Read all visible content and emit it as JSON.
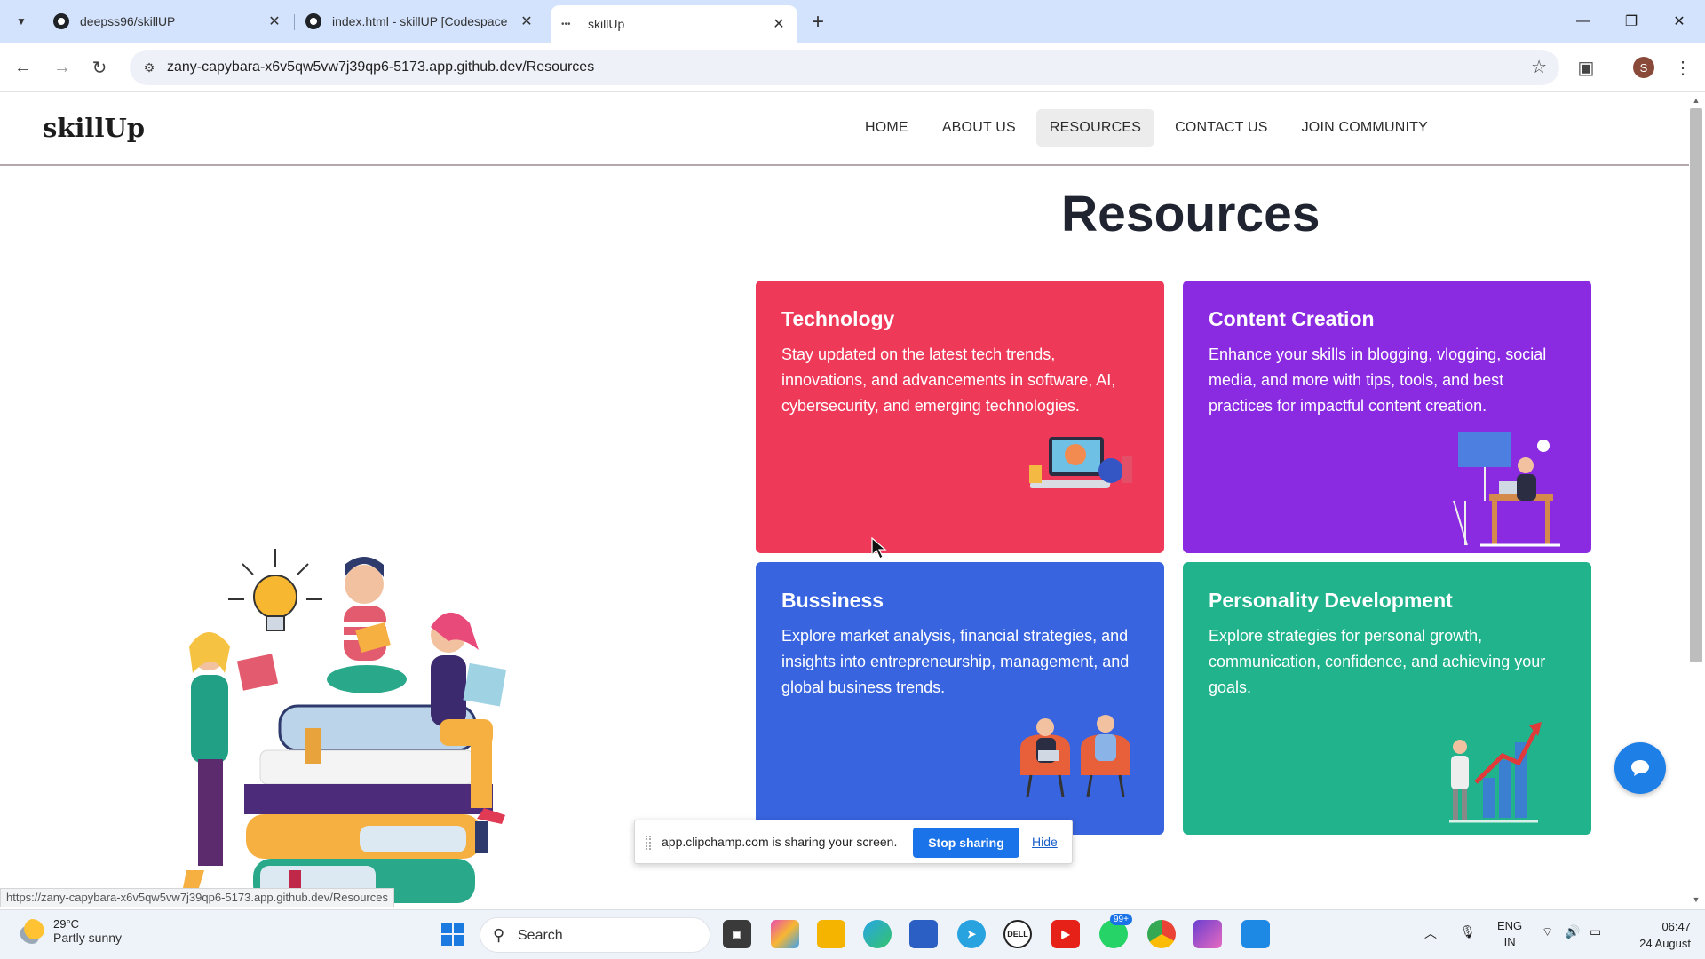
{
  "browser": {
    "tabs": [
      {
        "title": "deepss96/skillUP",
        "active": false
      },
      {
        "title": "index.html - skillUP [Codespace",
        "active": false
      },
      {
        "title": "skillUp",
        "active": true
      }
    ],
    "url": "zany-capybara-x6v5qw5vw7j39qp6-5173.app.github.dev/Resources",
    "profile_initial": "S"
  },
  "site": {
    "logo": "skillUp",
    "nav": [
      {
        "label": "HOME",
        "active": false
      },
      {
        "label": "ABOUT US",
        "active": false
      },
      {
        "label": "RESOURCES",
        "active": true
      },
      {
        "label": "CONTACT US",
        "active": false
      },
      {
        "label": "JOIN COMMUNITY",
        "active": false
      }
    ],
    "heading": "Resources",
    "cards": [
      {
        "title": "Technology",
        "text": "Stay updated on the latest tech trends, innovations, and advancements in software, AI, cybersecurity, and emerging technologies.",
        "color": "#ef3959"
      },
      {
        "title": "Content Creation",
        "text": "Enhance your skills in blogging, vlogging, social media, and more with tips, tools, and best practices for impactful content creation.",
        "color": "#8a2be2"
      },
      {
        "title": "Bussiness",
        "text": "Explore market analysis, financial strategies, and insights into entrepreneurship, management, and global business trends.",
        "color": "#3864e0"
      },
      {
        "title": "Personality Development",
        "text": "Explore strategies for personal growth, communication, confidence, and achieving your goals.",
        "color": "#21b38b"
      }
    ]
  },
  "share_bar": {
    "message": "app.clipchamp.com is sharing your screen.",
    "stop_label": "Stop sharing",
    "hide_label": "Hide"
  },
  "status_url": "https://zany-capybara-x6v5qw5vw7j39qp6-5173.app.github.dev/Resources",
  "taskbar": {
    "weather_temp": "29°C",
    "weather_desc": "Partly sunny",
    "search_label": "Search",
    "whatsapp_badge": "99+",
    "lang_line1": "ENG",
    "lang_line2": "IN",
    "time": "06:47",
    "date": "24 August"
  }
}
